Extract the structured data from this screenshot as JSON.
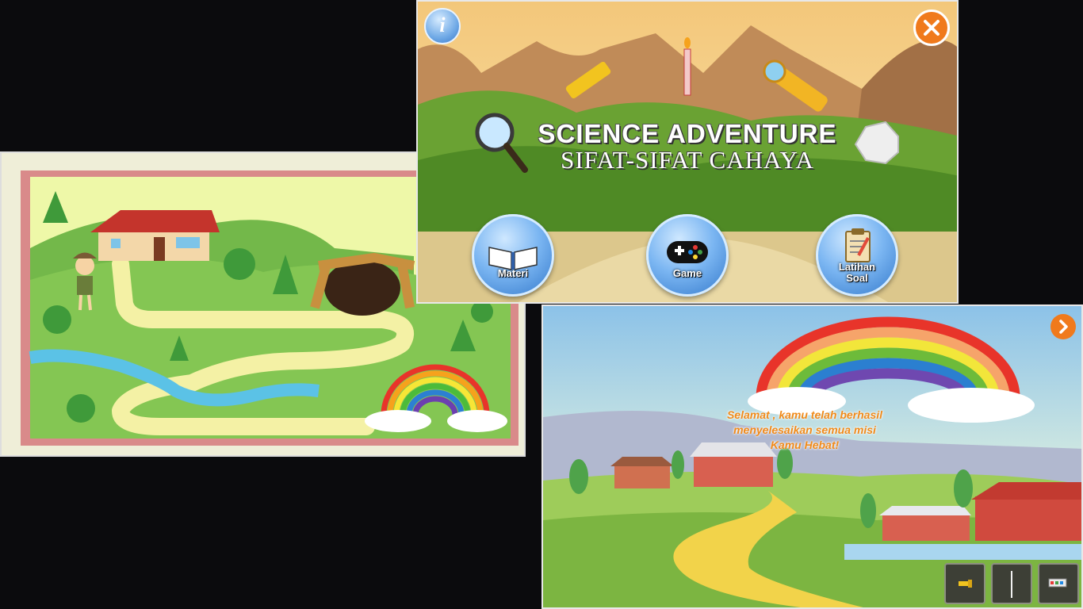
{
  "menu": {
    "title": "SCIENCE ADVENTURE",
    "subtitle": "SIFAT-SIFAT CAHAYA",
    "info_icon": "info-icon",
    "close_icon": "close-icon",
    "buttons": [
      {
        "label": "Materi",
        "icon": "book-icon"
      },
      {
        "label": "Game",
        "icon": "gamepad-icon"
      },
      {
        "label_line1": "Latihan",
        "label_line2": "Soal",
        "icon": "clipboard-icon"
      }
    ]
  },
  "ending": {
    "message_line1": "Selamat , kamu telah berhasil",
    "message_line2": "menyelesaikan semua misi",
    "message_line3": "Kamu Hebat!",
    "next_icon": "chevron-right-icon",
    "inventory": [
      "flashlight-item",
      "candle-item",
      "lantern-item"
    ]
  },
  "colors": {
    "accent_orange": "#f07a1c",
    "button_blue": "#3f86d6",
    "message_orange": "#f08a1a"
  }
}
